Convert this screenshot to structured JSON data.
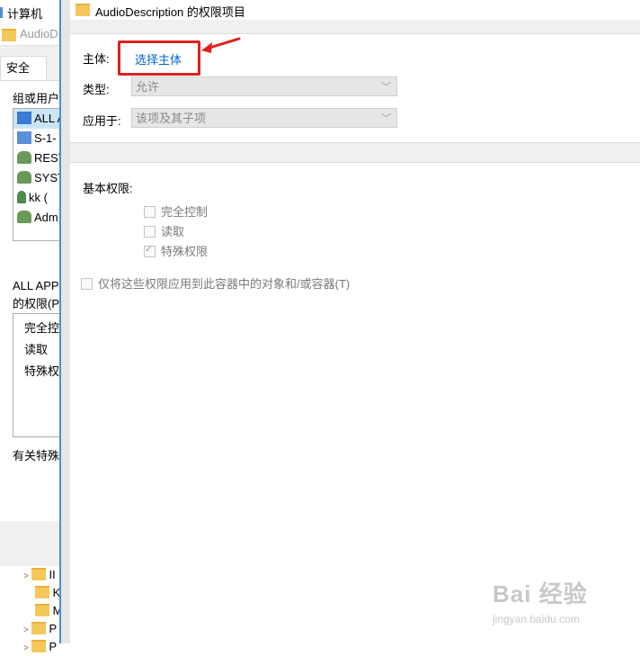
{
  "background_window": {
    "title": "计算机",
    "path_item": "AudioD",
    "tab_security": "安全",
    "group_label": "组或用户",
    "users": [
      {
        "label": "ALL A",
        "icon": "app-package-icon"
      },
      {
        "label": "S-1-",
        "icon": "app-package-icon"
      },
      {
        "label": "REST",
        "icon": "user-group-icon"
      },
      {
        "label": "SYST",
        "icon": "user-group-icon"
      },
      {
        "label": "kk (",
        "icon": "user-icon"
      },
      {
        "label": "Adm",
        "icon": "user-group-icon"
      }
    ],
    "perm_label_1": "ALL APPL",
    "perm_label_2": "的权限(P)",
    "permissions": [
      "完全控",
      "读取",
      "特殊权"
    ],
    "special_note": "有关特殊",
    "tree_items": [
      "II",
      "K",
      "M",
      "P",
      "P"
    ]
  },
  "dialog": {
    "title": "AudioDescription 的权限项目",
    "principal_label": "主体:",
    "select_principal": "选择主体",
    "type_label": "类型:",
    "type_value": "允许",
    "applies_label": "应用于:",
    "applies_value": "该项及其子项",
    "basic_perms_label": "基本权限:",
    "perms": [
      {
        "label": "完全控制",
        "checked": false
      },
      {
        "label": "读取",
        "checked": false
      },
      {
        "label": "特殊权限",
        "checked": true
      }
    ],
    "apply_only_label": "仅将这些权限应用到此容器中的对象和/或容器(T)"
  },
  "watermark": {
    "brand": "Bai 经验",
    "url": "jingyan.baidu.com"
  },
  "colors": {
    "accent_link": "#0066cc",
    "annotation_red": "#e02020",
    "divider_blue": "#4a90d9"
  }
}
